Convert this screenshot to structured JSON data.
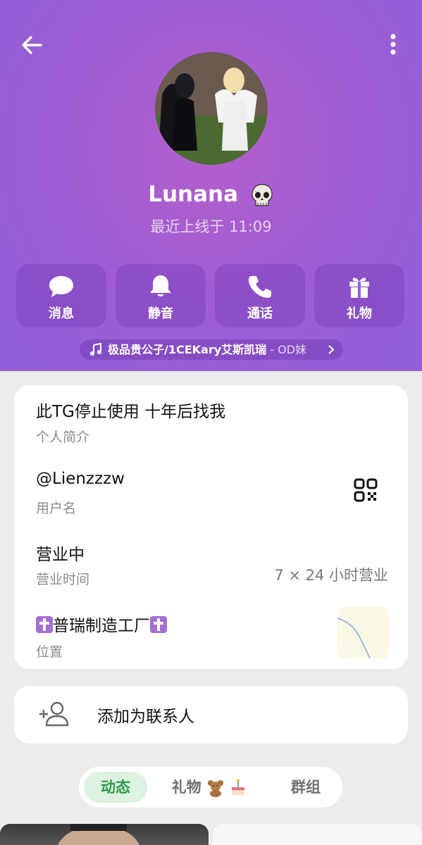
{
  "profile": {
    "name": "Lunana",
    "last_seen": "最近上线于 11:09"
  },
  "actions": [
    {
      "label": "消息",
      "icon": "message-icon"
    },
    {
      "label": "静音",
      "icon": "bell-icon"
    },
    {
      "label": "通话",
      "icon": "phone-icon"
    },
    {
      "label": "礼物",
      "icon": "gift-icon"
    }
  ],
  "music": {
    "title": "极品贵公子/1CEKary艾斯凯瑞",
    "artist": " - OD妹"
  },
  "info": {
    "bio": "此TG停止使用 十年后找我",
    "bio_label": "个人简介",
    "username": "@Lienzzzw",
    "username_label": "用户名",
    "business_status": "营业中",
    "business_label": "营业时间",
    "business_hours": "7 × 24 小时营业",
    "location_name": "普瑞制造工厂",
    "location_label": "位置"
  },
  "contact": {
    "add_label": "添加为联系人"
  },
  "tabs": {
    "posts": "动态",
    "gifts": "礼物",
    "groups": "群组"
  },
  "colors": {
    "header": "#9f5dd3",
    "tab_active_bg": "#ddf2e1",
    "tab_active_text": "#2f9a4a"
  }
}
